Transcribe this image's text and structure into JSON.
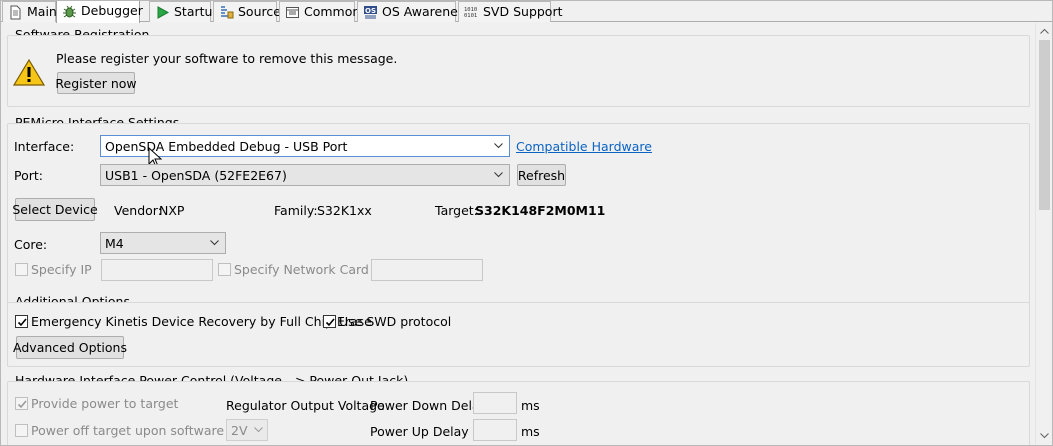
{
  "tabs": [
    {
      "label": "Main",
      "icon": "document-icon"
    },
    {
      "label": "Debugger",
      "icon": "bug-icon",
      "active": true
    },
    {
      "label": "Startup",
      "icon": "play-icon"
    },
    {
      "label": "Source",
      "icon": "source-icon"
    },
    {
      "label": "Common",
      "icon": "window-icon"
    },
    {
      "label": "OS Awareness",
      "icon": "os-icon"
    },
    {
      "label": "SVD Support",
      "icon": "binary-icon"
    }
  ],
  "registration": {
    "group_title": "Software Registration",
    "message": "Please register your software to remove this message.",
    "register_button": "Register now"
  },
  "interface_settings": {
    "group_title": "PEMicro Interface Settings",
    "interface_label": "Interface:",
    "interface_value": "OpenSDA Embedded Debug - USB Port",
    "compatible_link": "Compatible Hardware",
    "port_label": "Port:",
    "port_value": "USB1 - OpenSDA (52FE2E67)",
    "refresh_button": "Refresh",
    "select_device_button": "Select Device",
    "vendor_label": "Vendor:",
    "vendor_value": "NXP",
    "family_label": "Family:",
    "family_value": "S32K1xx",
    "target_label": "Target:",
    "target_value": "S32K148F2M0M11",
    "core_label": "Core:",
    "core_value": "M4",
    "specify_ip_label": "Specify IP",
    "specify_network_label": "Specify Network Card IP"
  },
  "additional_options": {
    "group_title": "Additional Options",
    "emergency_recovery_label": "Emergency Kinetis Device Recovery by Full Chip Erase",
    "emergency_recovery_checked": true,
    "swd_label": "Use SWD protocol",
    "swd_checked": true,
    "advanced_button": "Advanced Options"
  },
  "power_control": {
    "group_title": "Hardware Interface Power Control (Voltage --> Power-Out Jack)",
    "provide_power_label": "Provide power to target",
    "provide_power_checked": true,
    "regulator_label": "Regulator Output Voltage",
    "power_down_label": "Power Down Delay",
    "power_down_unit": "ms",
    "power_off_label": "Power off target upon software exit",
    "voltage_value": "2V",
    "power_up_label": "Power Up Delay",
    "power_up_unit": "ms"
  },
  "colors": {
    "link": "#0b63c4",
    "focus_border": "#5a8ed6",
    "warning_yellow": "#f5c518"
  }
}
